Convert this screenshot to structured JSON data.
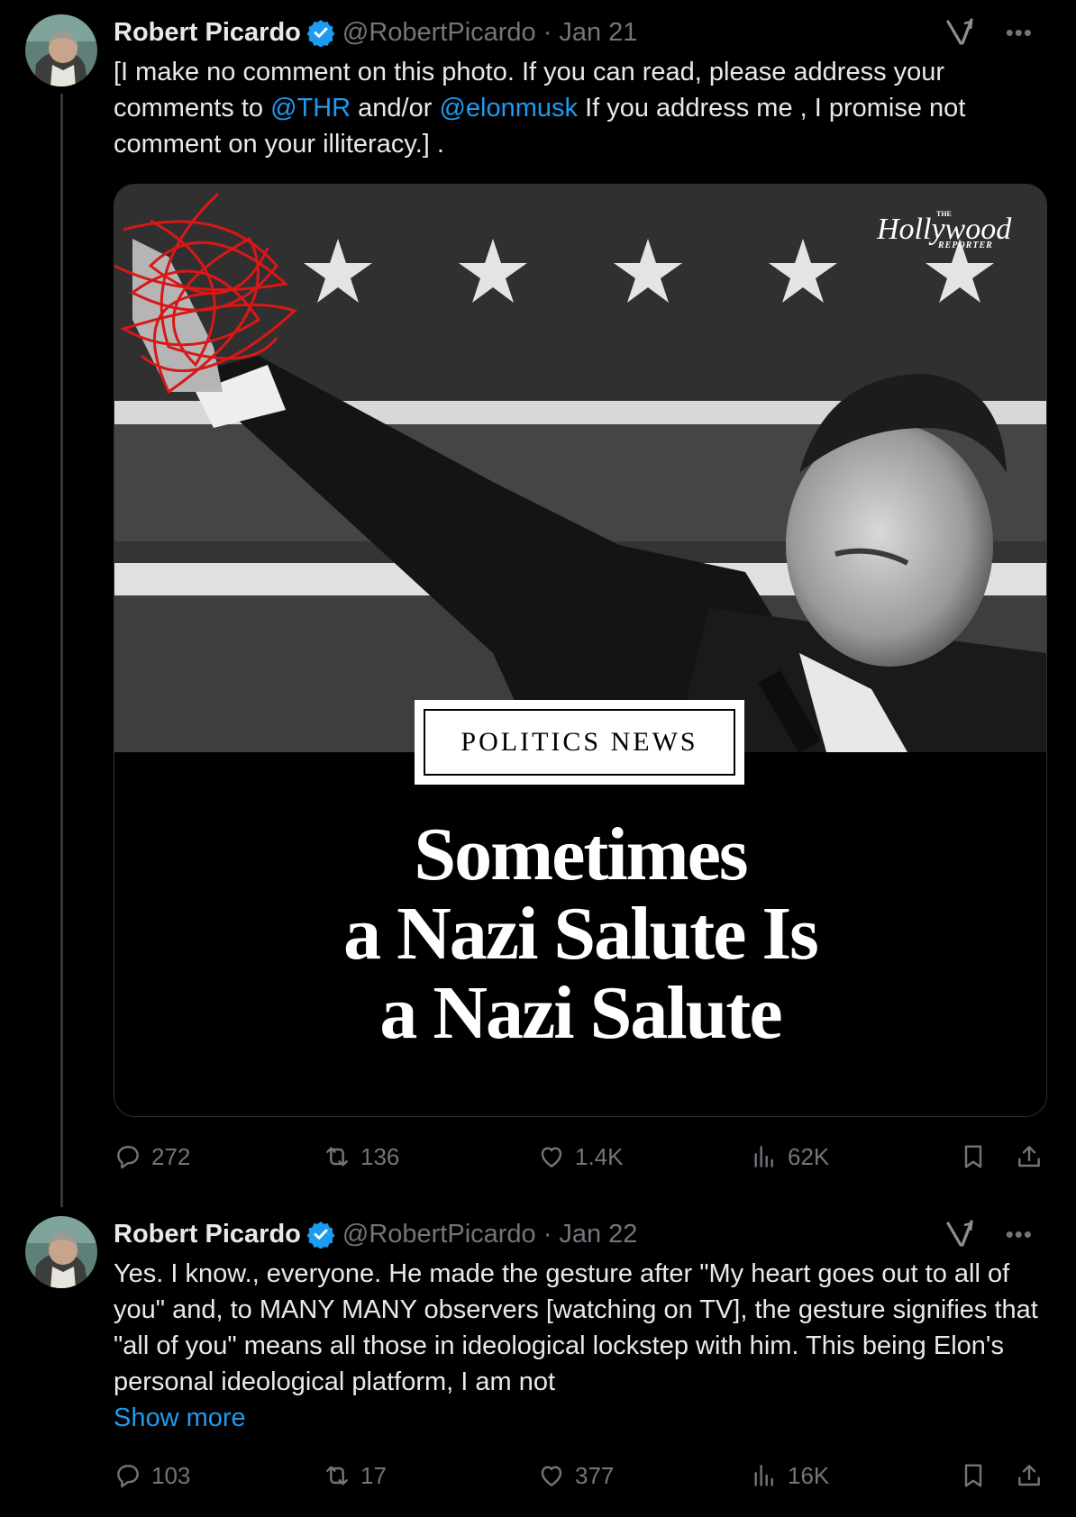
{
  "tweets": [
    {
      "author": {
        "name": "Robert Picardo",
        "handle": "@RobertPicardo",
        "verified": true
      },
      "separator": "·",
      "date": "Jan 21",
      "text_parts": {
        "p1": "[I make no comment on this photo. If you can read, please address your comments to ",
        "m1": "@THR",
        "p2": " and/or ",
        "m2": "@elonmusk",
        "p3": " If you address me , I promise not comment on your illiteracy.] ."
      },
      "media": {
        "logo_the": "THE",
        "logo_main": "Hollywood",
        "logo_sub": "REPORTER",
        "section_label": "POLITICS NEWS",
        "headline": [
          "Sometimes",
          "a Nazi Salute Is",
          "a Nazi Salute"
        ]
      },
      "stats": {
        "replies": "272",
        "reposts": "136",
        "likes": "1.4K",
        "views": "62K"
      }
    },
    {
      "author": {
        "name": "Robert Picardo",
        "handle": "@RobertPicardo",
        "verified": true
      },
      "separator": "·",
      "date": "Jan 22",
      "text": "Yes. I know., everyone. He made the gesture after \"My heart goes out to all of you\" and, to MANY MANY observers [watching on TV], the gesture signifies that  \"all of you\" means all those in ideological lockstep with him. This being Elon's personal ideological platform, I am not",
      "show_more": "Show more",
      "stats": {
        "replies": "103",
        "reposts": "17",
        "likes": "377",
        "views": "16K"
      }
    }
  ],
  "icons": {
    "more": "more-icon",
    "grok": "grok-icon",
    "reply": "reply-icon",
    "repost": "repost-icon",
    "like": "like-icon",
    "views": "views-icon",
    "bookmark": "bookmark-icon",
    "share": "share-icon"
  },
  "colors": {
    "background": "#000000",
    "text": "#e7e9ea",
    "muted": "#71767b",
    "link": "#1d9bf0",
    "verified": "#1d9bf0"
  }
}
